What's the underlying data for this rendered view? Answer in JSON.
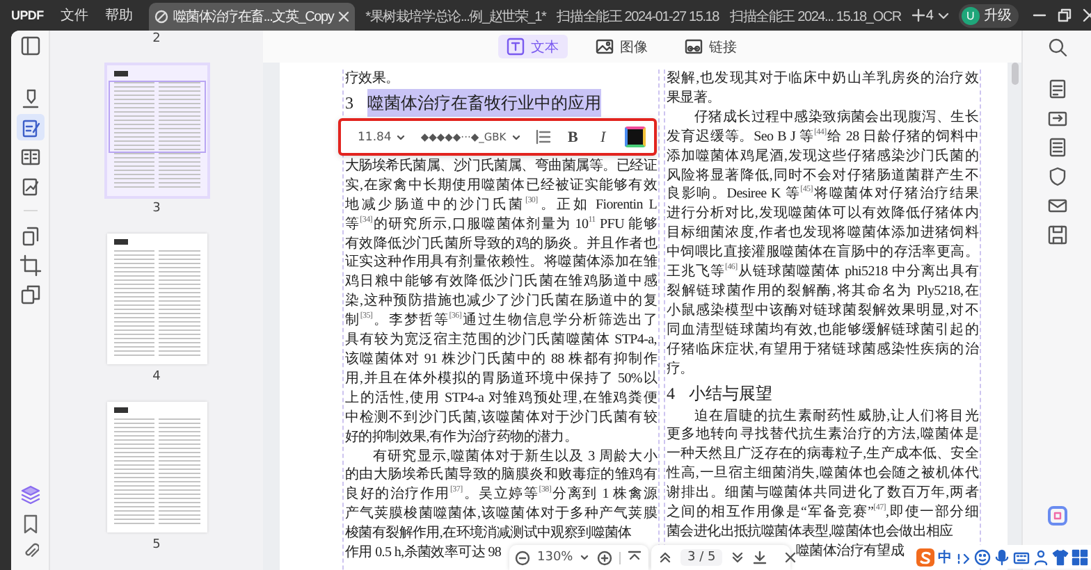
{
  "app": {
    "logo": "UPDF",
    "menu": [
      "文件",
      "帮助"
    ]
  },
  "doc_tabs": [
    {
      "label": "噬菌体治疗在畜...文英_Copy",
      "selected": true
    },
    {
      "label": "*果树栽培学总论...例_赵世荣_1*",
      "selected": false
    },
    {
      "label": "扫描全能王 2024-01-27 15.18",
      "selected": false
    },
    {
      "label": "扫描全能王 2024... 15.18_OCR",
      "selected": false
    }
  ],
  "window_count": "4",
  "account": {
    "avatar": "U",
    "upgrade": "升级"
  },
  "tools": [
    {
      "kind": "highlight",
      "selected": false
    },
    {
      "kind": "edit",
      "selected": true
    },
    {
      "kind": "form",
      "selected": false
    },
    {
      "kind": "sign",
      "selected": false
    },
    {
      "kind": "organize",
      "selected": false
    },
    {
      "kind": "crop",
      "selected": false
    },
    {
      "kind": "convert",
      "selected": false
    }
  ],
  "edit_modes": [
    {
      "label": "文本",
      "selected": true
    },
    {
      "label": "图像",
      "selected": false
    },
    {
      "label": "链接",
      "selected": false
    }
  ],
  "thumbnails": {
    "top_label": "2",
    "pages": [
      {
        "label": "3",
        "selected": true
      },
      {
        "label": "4",
        "selected": false
      },
      {
        "label": "5",
        "selected": false
      }
    ]
  },
  "document": {
    "columns": [
      {
        "blocks": [
          {
            "kind": "para",
            "indent": false,
            "lines": [
              {
                "text": "疗效果。"
              }
            ]
          },
          {
            "kind": "heading",
            "number": "3",
            "title": "噬菌体治疗在畜牧行业中的应用",
            "selected": true
          },
          {
            "kind": "para",
            "indent": false,
            "lines": [
              {
                "text": "大肠埃希氏菌属、沙门氏菌属、弯曲菌属等。已经证"
              },
              {
                "text": "实,在家禽中长期使用噬菌体已经被证实能够有效"
              },
              {
                "text": "地减少肠道中的沙门氏菌$^{[30]}$。正如 Fiorentin L"
              },
              {
                "text": "等$^{[34]}$的研究所示,口服噬菌体剂量为 10$^{11}$ PFU 能够"
              },
              {
                "text": "有效降低沙门氏菌所导致的鸡的肠炎。并且作者也"
              },
              {
                "text": "证实这种作用具有剂量依赖性。将噬菌体添加在雏"
              },
              {
                "text": "鸡日粮中能够有效降低沙门氏菌在雏鸡肠道中感"
              },
              {
                "text": "染,这种预防措施也减少了沙门氏菌在肠道中的复"
              },
              {
                "text": "制$^{[35]}$。李梦哲等$^{[36]}$通过生物信息学分析筛选出了"
              },
              {
                "text": "具有较为宽泛宿主范围的沙门氏菌噬菌体 STP4-a,"
              },
              {
                "text": "该噬菌体对 91 株沙门氏菌中的 88 株都有抑制作"
              },
              {
                "text": "用,并且在体外模拟的胃肠道环境中保持了 50%以"
              },
              {
                "text": "上的活性,使用 STP4-a 对雏鸡预处理,在雏鸡粪便"
              },
              {
                "text": "中检测不到沙门氏菌,该噬菌体对于沙门氏菌有较"
              },
              {
                "text": "好的抑制效果,有作为治疗药物的潜力。"
              }
            ]
          },
          {
            "kind": "para",
            "indent": true,
            "lines": [
              {
                "text": "有研究显示,噬菌体对于新生以及 3 周龄大小"
              },
              {
                "text": "的由大肠埃希氏菌导致的脑膜炎和败毒症的雏鸡有"
              },
              {
                "text": "良好的治疗作用$^{[37]}$。吴立婷等$^{[38]}$分离到 1 株禽源"
              },
              {
                "text": "产气荚膜梭菌噬菌体,该噬菌体对于多种产气荚膜"
              },
              {
                "text": "梭菌有裂解作用,在环境消减测试中观察到噬菌体"
              }
            ]
          },
          {
            "kind": "cut_line",
            "text": "作用 0.5 h,杀菌效率可达 98"
          }
        ]
      },
      {
        "blocks": [
          {
            "kind": "para",
            "indent": false,
            "lines": [
              {
                "text": "裂解,也发现其对于临床中奶山羊乳房炎的治疗效"
              },
              {
                "text": "果显著。"
              }
            ]
          },
          {
            "kind": "para",
            "indent": true,
            "lines": [
              {
                "text": "仔猪成长过程中感染致病菌会出现腹泻、生长"
              },
              {
                "text": "发育迟缓等。Seo B J 等$^{[44]}$给 28 日龄仔猪的饲料中"
              },
              {
                "text": "添加噬菌体鸡尾酒,发现这些仔猪感染沙门氏菌的"
              },
              {
                "text": "风险将显著降低,同时不会对仔猪肠道菌群产生不"
              },
              {
                "text": "良影响。Desiree K 等$^{[45]}$将噬菌体对仔猪治疗结果"
              },
              {
                "text": "进行分析对比,发现噬菌体可以有效降低仔猪体内"
              },
              {
                "text": "目标细菌浓度,作者也发现将噬菌体添加进猪饲料"
              },
              {
                "text": "中饲喂比直接灌服噬菌体在盲肠中的存活率更高。"
              },
              {
                "text": "王兆飞等$^{[46]}$从链球菌噬菌体 phi5218 中分离出具有"
              },
              {
                "text": "裂解链球菌作用的裂解酶,将其命名为 Ply5218,在"
              },
              {
                "text": "小鼠感染模型中该酶对链球菌裂解效果明显,对不"
              },
              {
                "text": "同血清型链球菌均有效,也能够缓解链球菌引起的"
              },
              {
                "text": "仔猪临床症状,有望用于猪链球菌感染性疾病的治"
              },
              {
                "text": "疗。"
              }
            ]
          },
          {
            "kind": "heading",
            "number": "4",
            "title": "小结与展望",
            "selected": false
          },
          {
            "kind": "para",
            "indent": true,
            "lines": [
              {
                "text": "迫在眉睫的抗生素耐药性威胁,让人们将目光"
              },
              {
                "text": "更多地转向寻找替代抗生素治疗的方法,噬菌体是"
              },
              {
                "text": "一种天然且广泛存在的病毒粒子,生产成本低、安全"
              },
              {
                "text": "性高,一旦宿主细菌消失,噬菌体也会随之被机体代"
              },
              {
                "text": "谢排出。细菌与噬菌体共同进化了数百万年,两者"
              },
              {
                "text": "之间的相互作用像是“军备竞赛”$^{[47]}$,即使一部分细"
              },
              {
                "text": "菌会进化出抵抗噬菌体表型,噬菌体也会做出相应"
              }
            ]
          },
          {
            "kind": "hidden_start_line",
            "text": "噬菌体治疗有望成"
          }
        ]
      }
    ]
  },
  "format_bar": {
    "font_size": "11.84",
    "font_name": "◆◆◆◆◆···◆_GBK",
    "bold": "B",
    "italic": "I"
  },
  "zoom_bar": {
    "zoom": "130%"
  },
  "page_nav": {
    "page": "3 / 5"
  },
  "ime": {
    "mode": "中"
  }
}
